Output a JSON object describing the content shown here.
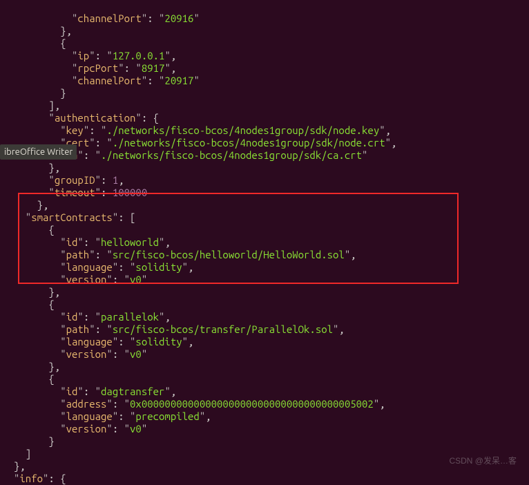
{
  "tooltip": "ibreOffice Writer",
  "watermark": "CSDN @发呆…客",
  "code": {
    "l1": {
      "channelPort_k": "channelPort",
      "channelPort_v": "20916"
    },
    "l5": {
      "ip_k": "ip",
      "ip_v": "127.0.0.1"
    },
    "l6": {
      "rpcPort_k": "rpcPort",
      "rpcPort_v": "8917"
    },
    "l7": {
      "channelPort_k": "channelPort",
      "channelPort_v": "20917"
    },
    "l10": {
      "auth_k": "authentication"
    },
    "l11": {
      "key_k": "key",
      "key_v": "./networks/fisco-bcos/4nodes1group/sdk/node.key"
    },
    "l12": {
      "cert_k": "cert",
      "cert_v": "./networks/fisco-bcos/4nodes1group/sdk/node.crt"
    },
    "l13": {
      "ca_k": "ca",
      "ca_v": "./networks/fisco-bcos/4nodes1group/sdk/ca.crt"
    },
    "l15": {
      "groupID_k": "groupID",
      "groupID_v": "1"
    },
    "l16": {
      "timeout_k": "timeout",
      "timeout_v": "100000"
    },
    "l18": {
      "sc_k": "smartContracts"
    },
    "l20": {
      "id_k": "id",
      "id_v": "helloworld"
    },
    "l21": {
      "path_k": "path",
      "path_v": "src/fisco-bcos/helloworld/HelloWorld.sol"
    },
    "l22": {
      "lang_k": "language",
      "lang_v": "solidity"
    },
    "l23": {
      "ver_k": "version",
      "ver_v": "v0"
    },
    "l26": {
      "id_k": "id",
      "id_v": "parallelok"
    },
    "l27": {
      "path_k": "path",
      "path_v": "src/fisco-bcos/transfer/ParallelOk.sol"
    },
    "l28": {
      "lang_k": "language",
      "lang_v": "solidity"
    },
    "l29": {
      "ver_k": "version",
      "ver_v": "v0"
    },
    "l32": {
      "id_k": "id",
      "id_v": "dagtransfer"
    },
    "l33": {
      "addr_k": "address",
      "addr_v": "0x0000000000000000000000000000000000005002"
    },
    "l34": {
      "lang_k": "language",
      "lang_v": "precompiled"
    },
    "l35": {
      "ver_k": "version",
      "ver_v": "v0"
    },
    "l39": {
      "info_k": "info"
    }
  }
}
